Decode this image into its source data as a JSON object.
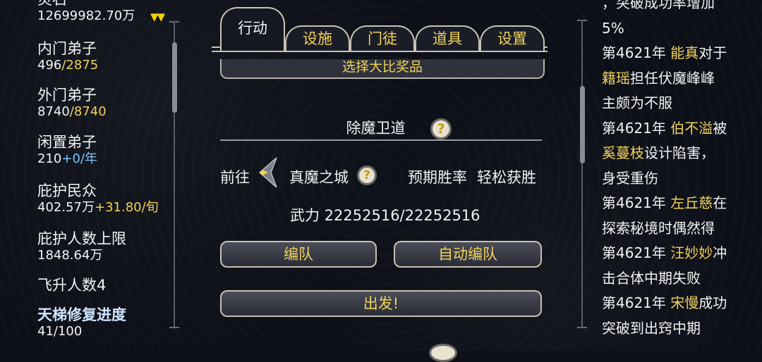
{
  "left_panel": {
    "stone_label": "灵石",
    "stone_value": "12699982.70万",
    "inner_disciples": {
      "label": "内门弟子",
      "current": "496",
      "max": "/2875"
    },
    "outer_disciples": {
      "label": "外门弟子",
      "current": "8740",
      "max": "/8740"
    },
    "idle_disciples": {
      "label": "闲置弟子",
      "value": "210",
      "rate": "+0/年"
    },
    "protected_people": {
      "label": "庇护民众",
      "value": "402.57万",
      "rate": "+31.80/旬"
    },
    "protect_cap": {
      "label": "庇护人数上限",
      "value": "1848.64万"
    },
    "ascended": {
      "label": "飞升人数4"
    },
    "ladder": {
      "label": "天梯修复进度",
      "value": "41/100"
    }
  },
  "tabs": [
    {
      "label": "行动",
      "active": true
    },
    {
      "label": "设施"
    },
    {
      "label": "门徒"
    },
    {
      "label": "道具"
    },
    {
      "label": "设置"
    }
  ],
  "banner": "选择大比奖品",
  "section_title": "除魔卫道",
  "goto_label": "前往",
  "destination": "真魔之城",
  "win_rate_label": "预期胜率",
  "win_rate_value": "轻松获胜",
  "power": "武力 22252516/22252516",
  "buttons": {
    "team": "编队",
    "auto_team": "自动编队",
    "depart": "出发!"
  },
  "help_glyph": "?",
  "log": [
    {
      "pre": "，突破成功率增加",
      "name": "",
      "post": ""
    },
    {
      "pre": "5%",
      "name": "",
      "post": ""
    },
    {
      "pre": "第4621年 ",
      "name": "能真",
      "post": "对于"
    },
    {
      "pre": "",
      "name": "籍瑶",
      "post": "担任伏魔峰峰"
    },
    {
      "pre": "主颇为不服",
      "name": "",
      "post": ""
    },
    {
      "pre": "第4621年 ",
      "name": "伯不溢",
      "post": "被"
    },
    {
      "pre": "",
      "name": "奚蔓枝",
      "post": "设计陷害，"
    },
    {
      "pre": "身受重伤",
      "name": "",
      "post": ""
    },
    {
      "pre": "第4621年 ",
      "name": "左丘慈",
      "post": "在"
    },
    {
      "pre": "探索秘境时偶然得",
      "name": "",
      "post": ""
    },
    {
      "pre": "第4621年 ",
      "name": "汪妙妙",
      "post": "冲"
    },
    {
      "pre": "击合体中期失败",
      "name": "",
      "post": ""
    },
    {
      "pre": "第4621年 ",
      "name": "宋慢",
      "post": "成功"
    },
    {
      "pre": "突破到出窍中期",
      "name": "",
      "post": ""
    }
  ],
  "colors": {
    "gold": "#f1d25a",
    "blue": "#7cc6ff"
  }
}
